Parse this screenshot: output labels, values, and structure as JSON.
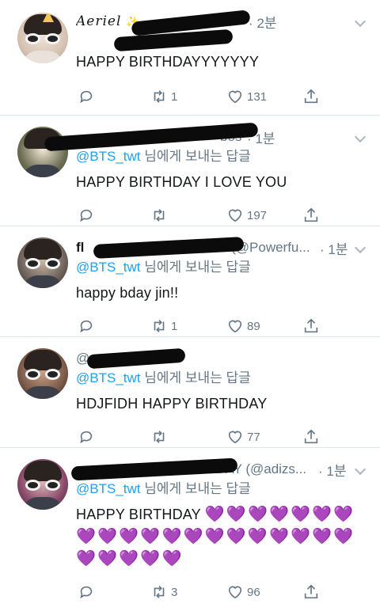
{
  "tweets": [
    {
      "name": "Aeriel",
      "name_emoji": "✨",
      "time": "· 2분",
      "reply_prefix": "",
      "reply_mention": "",
      "reply_suffix": "",
      "text": "HAPPY BIRTHDAYYYYYYY",
      "hearts": [],
      "reply_count": "",
      "retweet_count": "1",
      "like_count": "131"
    },
    {
      "name": "",
      "handle": "bos",
      "time": "· 1분",
      "reply_prefix": "",
      "reply_mention": "@BTS_twt",
      "reply_suffix": " 님에게 보내는 답글",
      "text": "HAPPY BIRTHDAY I LOVE YOU",
      "hearts": [],
      "reply_count": "",
      "retweet_count": "",
      "like_count": "197"
    },
    {
      "name": "fl",
      "handle": "DAY (@Powerfu...",
      "time": "· 1분",
      "reply_mention": "@BTS_twt",
      "reply_suffix": " 님에게 보내는 답글",
      "text": "happy bday jin!!",
      "hearts": [],
      "reply_count": "",
      "retweet_count": "1",
      "like_count": "89"
    },
    {
      "name": "",
      "handle": "@",
      "time": "",
      "reply_mention": "@BTS_twt",
      "reply_suffix": " 님에게 보내는 답글",
      "text": "HDJFIDH HAPPY BIRTHDAY",
      "hearts": [],
      "reply_count": "",
      "retweet_count": "",
      "like_count": "77"
    },
    {
      "name": "",
      "handle": "JIN DAY (@adizs...",
      "time": "· 1분",
      "reply_mention": "@BTS_twt",
      "reply_suffix": " 님에게 보내는 답글",
      "text": "HAPPY BIRTHDAY",
      "hearts": [
        "💜",
        "💜",
        "💜",
        "💜",
        "💜",
        "💜",
        "💜",
        "💜",
        "💜",
        "💜",
        "💜",
        "💜",
        "💜",
        "💜",
        "💜",
        "💜",
        "💜",
        "💜",
        "💜",
        "💜",
        "💜",
        "💜",
        "💜",
        "💜",
        "💜"
      ],
      "reply_count": "",
      "retweet_count": "3",
      "like_count": "96"
    }
  ],
  "colors": {
    "text": "#14171a",
    "secondary": "#657786",
    "mention": "#1da1f2",
    "heart": "#9b3df2",
    "divider": "#e1e8ed"
  },
  "icons": {
    "reply": "reply-icon",
    "retweet": "retweet-icon",
    "like": "like-icon",
    "share": "share-icon",
    "more": "chevron-down-icon"
  }
}
